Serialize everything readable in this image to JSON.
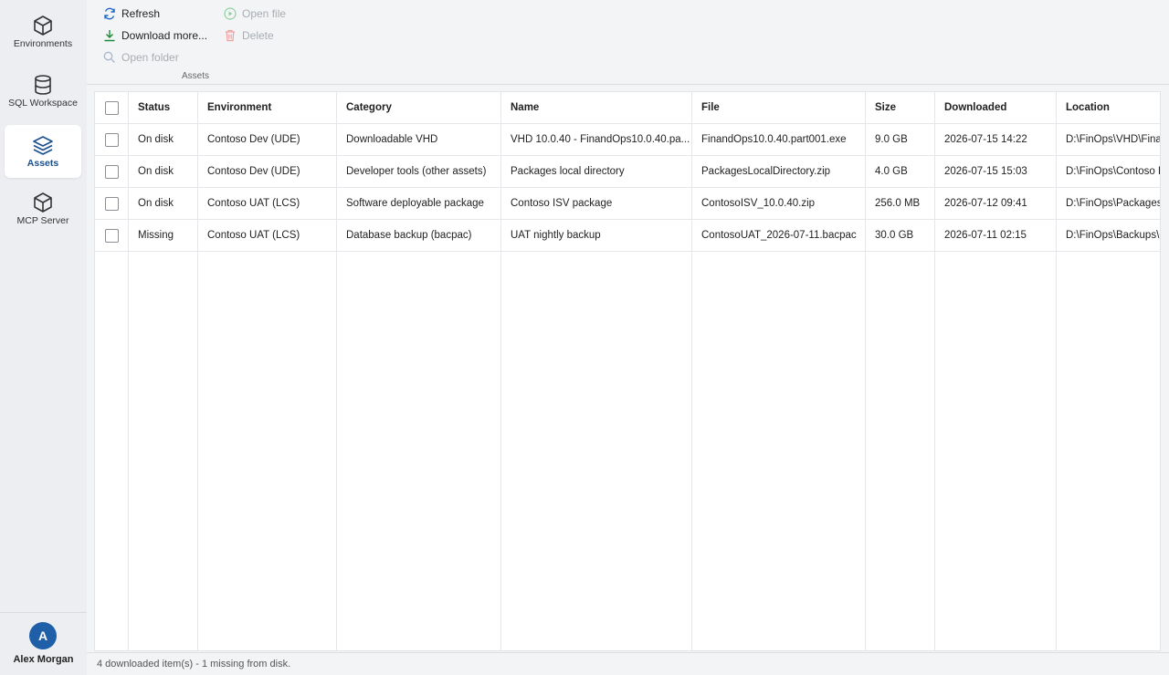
{
  "sidebar": {
    "items": [
      {
        "label": "Environments",
        "icon": "cube-icon",
        "active": false
      },
      {
        "label": "SQL Workspace",
        "icon": "database-icon",
        "active": false
      },
      {
        "label": "Assets",
        "icon": "layers-icon",
        "active": true
      },
      {
        "label": "MCP Server",
        "icon": "cube-icon",
        "active": false
      }
    ],
    "user": {
      "initial": "A",
      "name": "Alex Morgan"
    }
  },
  "toolbar": {
    "refresh": "Refresh",
    "download_more": "Download more...",
    "open_folder": "Open folder",
    "open_file": "Open file",
    "delete": "Delete",
    "group_label": "Assets"
  },
  "table": {
    "columns": [
      "Status",
      "Environment",
      "Category",
      "Name",
      "File",
      "Size",
      "Downloaded",
      "Location"
    ],
    "rows": [
      [
        "On disk",
        "Contoso Dev (UDE)",
        "Downloadable VHD",
        "VHD 10.0.40 - FinandOps10.0.40.pa...",
        "FinandOps10.0.40.part001.exe",
        "9.0 GB",
        "2026-07-15 14:22",
        "D:\\FinOps\\VHD\\Finan"
      ],
      [
        "On disk",
        "Contoso Dev (UDE)",
        "Developer tools (other assets)",
        "Packages local directory",
        "PackagesLocalDirectory.zip",
        "4.0 GB",
        "2026-07-15 15:03",
        "D:\\FinOps\\Contoso D"
      ],
      [
        "On disk",
        "Contoso UAT (LCS)",
        "Software deployable package",
        "Contoso ISV package",
        "ContosoISV_10.0.40.zip",
        "256.0 MB",
        "2026-07-12 09:41",
        "D:\\FinOps\\Packages\\"
      ],
      [
        "Missing",
        "Contoso UAT (LCS)",
        "Database backup (bacpac)",
        "UAT nightly backup",
        "ContosoUAT_2026-07-11.bacpac",
        "30.0 GB",
        "2026-07-11 02:15",
        "D:\\FinOps\\Backups\\C"
      ]
    ]
  },
  "status": {
    "text": "4 downloaded item(s) - 1 missing from disk."
  },
  "colors": {
    "accent": "#1f5fa8",
    "refresh_icon": "#1e63c6",
    "download_icon": "#1e8a3c",
    "open_file_icon": "#8fd19e",
    "delete_icon": "#f0a0a0"
  }
}
